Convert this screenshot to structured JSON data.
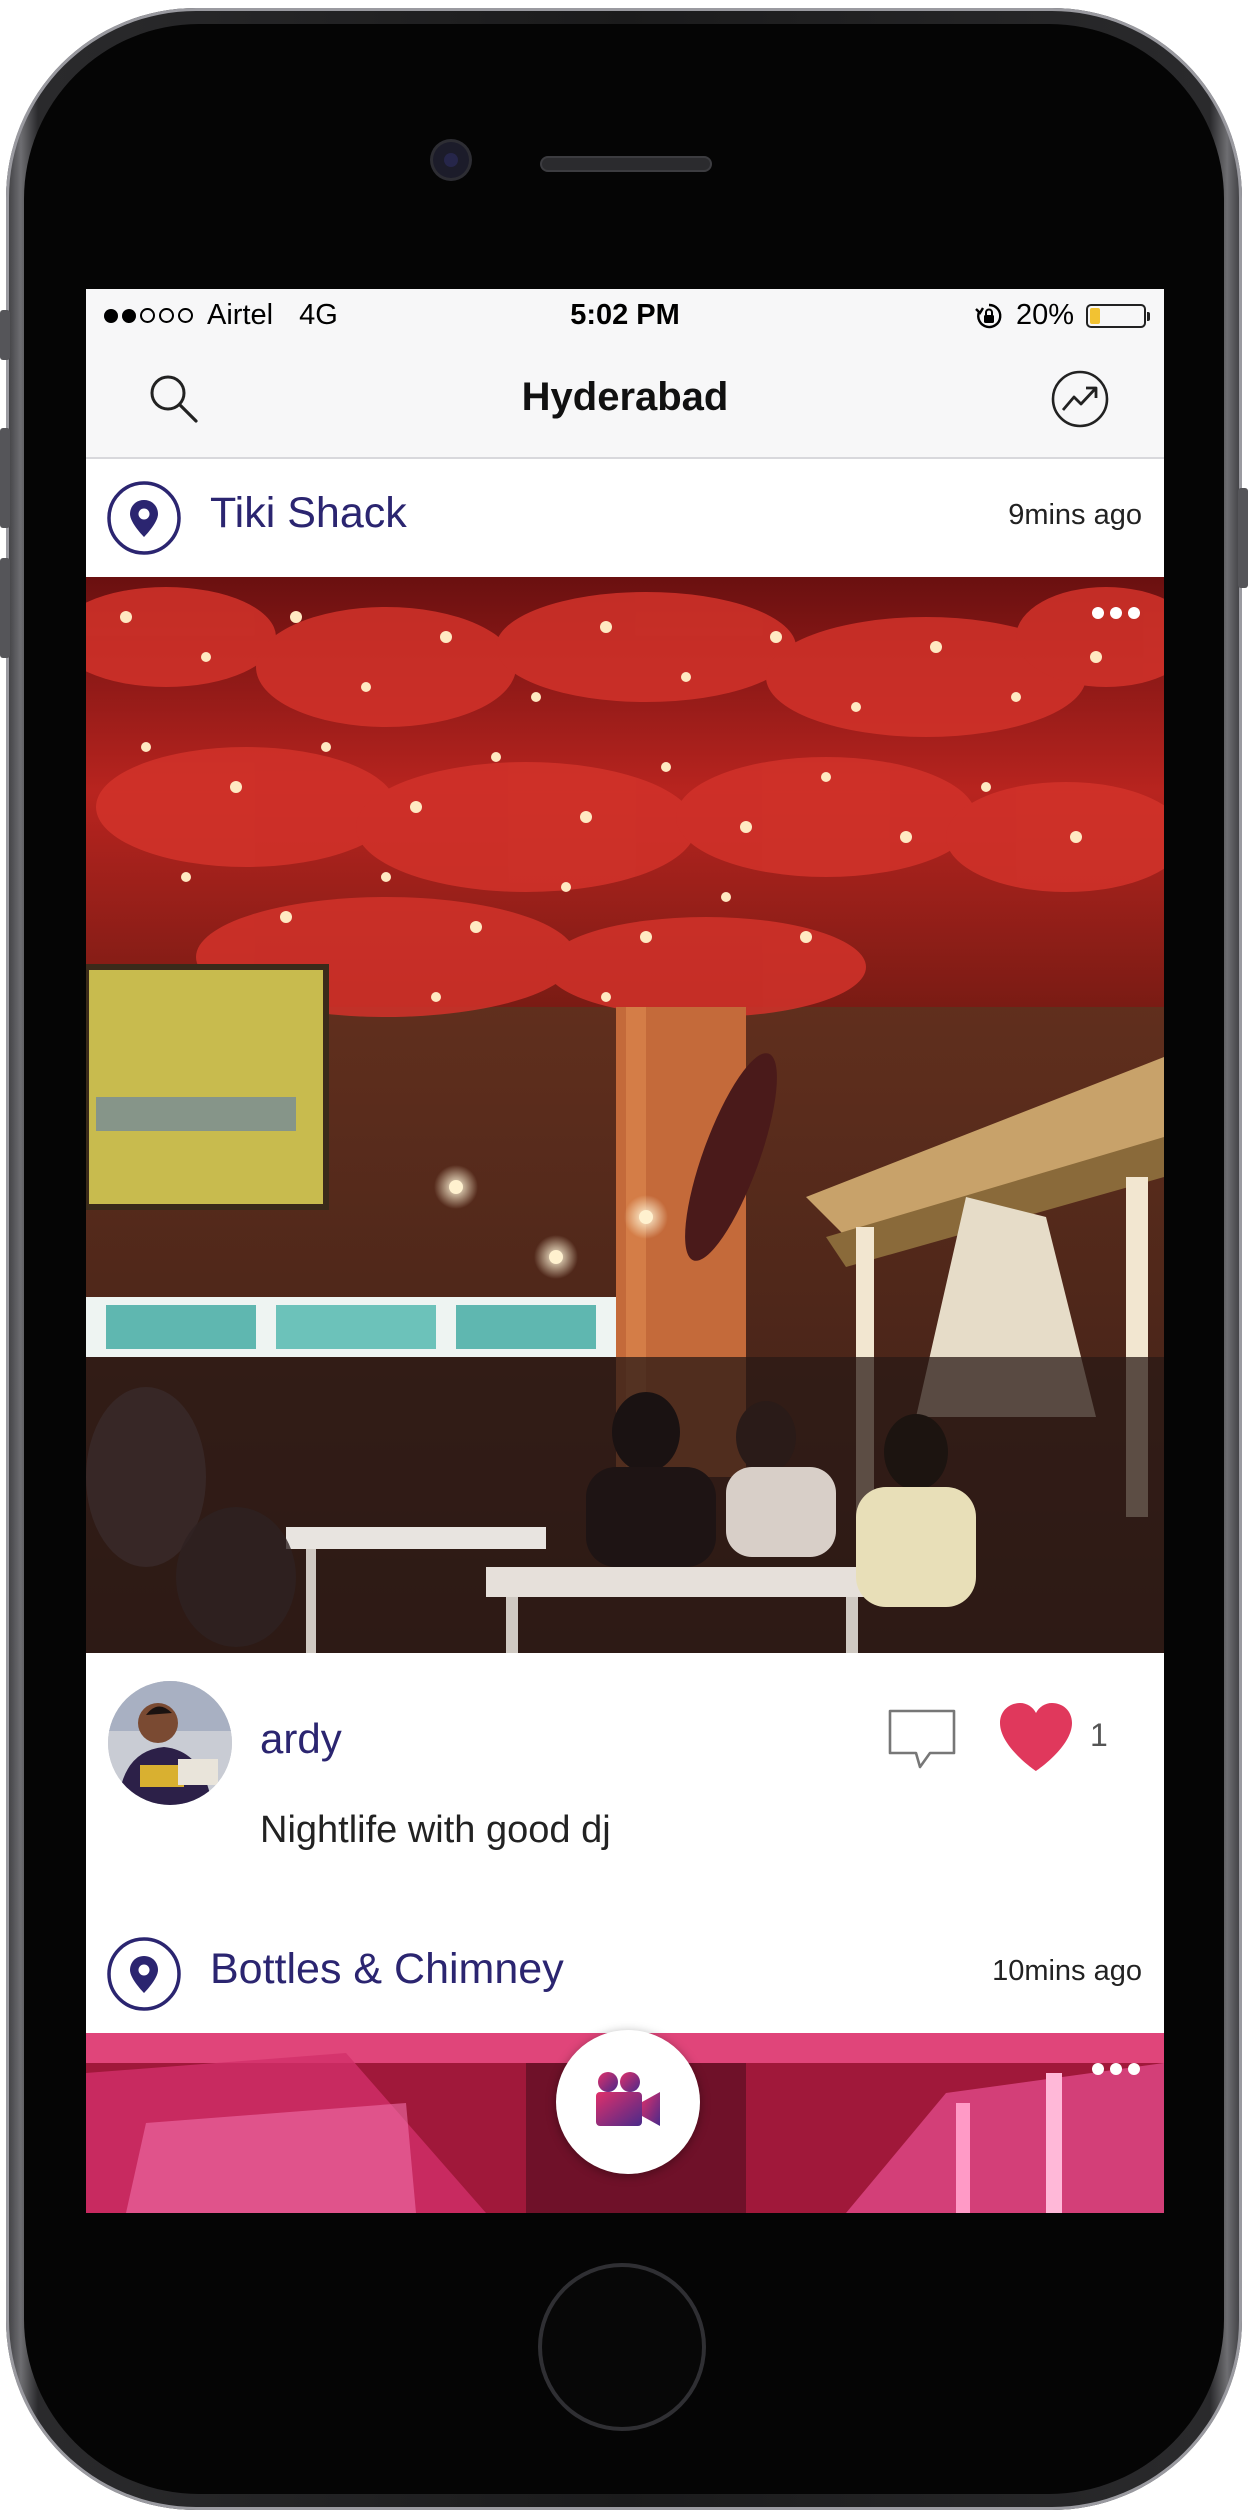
{
  "status_bar": {
    "carrier": "Airtel",
    "network": "4G",
    "time": "5:02 PM",
    "battery_text": "20%",
    "battery_level": 0.2,
    "signal_filled": 2,
    "signal_total": 5
  },
  "nav": {
    "title": "Hyderabad",
    "left_icon": "search-icon",
    "right_icon": "trending-icon"
  },
  "posts": [
    {
      "place": "Tiki Shack",
      "time_ago": "9mins ago",
      "username": "ardy",
      "caption": "Nightlife with good dj",
      "like_count": "1",
      "liked": true
    },
    {
      "place": "Bottles & Chimney",
      "time_ago": "10mins ago"
    }
  ],
  "fab": {
    "icon": "video-camera-icon"
  },
  "colors": {
    "accent": "#2b2570",
    "heart": "#e0385c",
    "fab_gradient_start": "#e0306a",
    "fab_gradient_end": "#4a2a8a"
  }
}
